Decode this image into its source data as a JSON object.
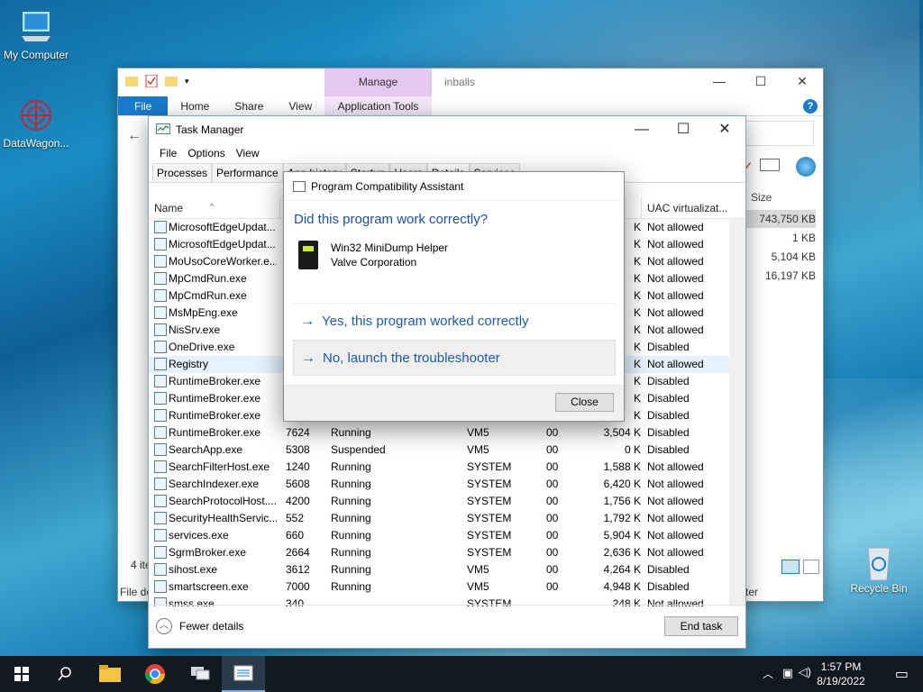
{
  "desktop": {
    "icons": [
      {
        "label": "My Computer"
      },
      {
        "label": "DataWagon..."
      },
      {
        "label": "Recycle Bin"
      }
    ]
  },
  "explorer": {
    "tabs": {
      "file": "File",
      "home": "Home",
      "share": "Share",
      "view": "View",
      "app_tools": "Application Tools"
    },
    "manage": "Manage",
    "title": "inballs",
    "size_header": "Size",
    "sizes": [
      "743,750 KB",
      "1 KB",
      "5,104 KB",
      "16,197 KB"
    ],
    "status_items": "4 ite",
    "status_file": "File de",
    "status_right": "ter"
  },
  "taskmanager": {
    "title": "Task Manager",
    "menu": [
      "File",
      "Options",
      "View"
    ],
    "tabs": [
      "Processes",
      "Performance",
      "App history",
      "Startup",
      "Users",
      "Details",
      "Services"
    ],
    "columns": {
      "name": "Name",
      "uac": "UAC virtualizat..."
    },
    "rows": [
      {
        "name": "MicrosoftEdgeUpdat...",
        "pid": "",
        "status": "",
        "user": "",
        "cpu": "",
        "mem": "K",
        "uac": "Not allowed"
      },
      {
        "name": "MicrosoftEdgeUpdat...",
        "pid": "",
        "status": "",
        "user": "",
        "cpu": "",
        "mem": "K",
        "uac": "Not allowed"
      },
      {
        "name": "MoUsoCoreWorker.e...",
        "pid": "",
        "status": "",
        "user": "",
        "cpu": "",
        "mem": "K",
        "uac": "Not allowed"
      },
      {
        "name": "MpCmdRun.exe",
        "pid": "",
        "status": "",
        "user": "",
        "cpu": "",
        "mem": "K",
        "uac": "Not allowed"
      },
      {
        "name": "MpCmdRun.exe",
        "pid": "",
        "status": "",
        "user": "",
        "cpu": "",
        "mem": "K",
        "uac": "Not allowed"
      },
      {
        "name": "MsMpEng.exe",
        "pid": "",
        "status": "",
        "user": "",
        "cpu": "",
        "mem": "K",
        "uac": "Not allowed"
      },
      {
        "name": "NisSrv.exe",
        "pid": "",
        "status": "",
        "user": "",
        "cpu": "",
        "mem": "K",
        "uac": "Not allowed"
      },
      {
        "name": "OneDrive.exe",
        "pid": "",
        "status": "",
        "user": "",
        "cpu": "",
        "mem": "K",
        "uac": "Disabled"
      },
      {
        "name": "Registry",
        "pid": "",
        "status": "",
        "user": "",
        "cpu": "",
        "mem": "K",
        "uac": "Not allowed"
      },
      {
        "name": "RuntimeBroker.exe",
        "pid": "",
        "status": "",
        "user": "",
        "cpu": "",
        "mem": "K",
        "uac": "Disabled"
      },
      {
        "name": "RuntimeBroker.exe",
        "pid": "",
        "status": "",
        "user": "",
        "cpu": "",
        "mem": "K",
        "uac": "Disabled"
      },
      {
        "name": "RuntimeBroker.exe",
        "pid": "",
        "status": "",
        "user": "",
        "cpu": "",
        "mem": "K",
        "uac": "Disabled"
      },
      {
        "name": "RuntimeBroker.exe",
        "pid": "7624",
        "status": "Running",
        "user": "VM5",
        "cpu": "00",
        "mem": "3,504 K",
        "uac": "Disabled"
      },
      {
        "name": "SearchApp.exe",
        "pid": "5308",
        "status": "Suspended",
        "user": "VM5",
        "cpu": "00",
        "mem": "0 K",
        "uac": "Disabled"
      },
      {
        "name": "SearchFilterHost.exe",
        "pid": "1240",
        "status": "Running",
        "user": "SYSTEM",
        "cpu": "00",
        "mem": "1,588 K",
        "uac": "Not allowed"
      },
      {
        "name": "SearchIndexer.exe",
        "pid": "5608",
        "status": "Running",
        "user": "SYSTEM",
        "cpu": "00",
        "mem": "6,420 K",
        "uac": "Not allowed"
      },
      {
        "name": "SearchProtocolHost....",
        "pid": "4200",
        "status": "Running",
        "user": "SYSTEM",
        "cpu": "00",
        "mem": "1,756 K",
        "uac": "Not allowed"
      },
      {
        "name": "SecurityHealthServic...",
        "pid": "552",
        "status": "Running",
        "user": "SYSTEM",
        "cpu": "00",
        "mem": "1,792 K",
        "uac": "Not allowed"
      },
      {
        "name": "services.exe",
        "pid": "660",
        "status": "Running",
        "user": "SYSTEM",
        "cpu": "00",
        "mem": "5,904 K",
        "uac": "Not allowed"
      },
      {
        "name": "SgrmBroker.exe",
        "pid": "2664",
        "status": "Running",
        "user": "SYSTEM",
        "cpu": "00",
        "mem": "2,636 K",
        "uac": "Not allowed"
      },
      {
        "name": "sihost.exe",
        "pid": "3612",
        "status": "Running",
        "user": "VM5",
        "cpu": "00",
        "mem": "4,264 K",
        "uac": "Disabled"
      },
      {
        "name": "smartscreen.exe",
        "pid": "7000",
        "status": "Running",
        "user": "VM5",
        "cpu": "00",
        "mem": "4,948 K",
        "uac": "Disabled"
      },
      {
        "name": "smss.exe",
        "pid": "340",
        "status": "",
        "user": "SYSTEM",
        "cpu": "",
        "mem": "248 K",
        "uac": "Not allowed"
      }
    ],
    "fewer_details": "Fewer details",
    "end_task": "End task"
  },
  "pca": {
    "title": "Program Compatibility Assistant",
    "question": "Did this program work correctly?",
    "program_name": "Win32 MiniDump Helper",
    "program_publisher": "Valve Corporation",
    "option_yes": "Yes, this program worked correctly",
    "option_no": "No, launch the troubleshooter",
    "close": "Close"
  },
  "taskbar": {
    "time": "1:57 PM",
    "date": "8/19/2022"
  },
  "colors": {
    "accent": "#1979ca",
    "link": "#1e5aa8",
    "manage": "#e3c8f0"
  }
}
